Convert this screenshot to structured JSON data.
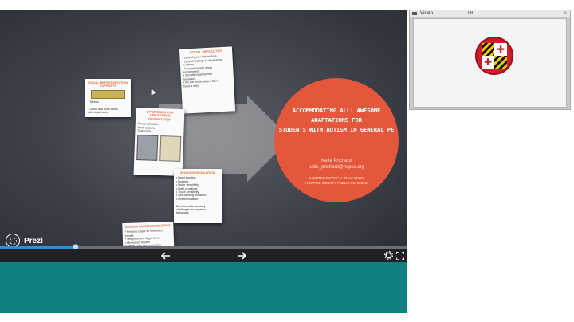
{
  "presentation": {
    "title": "ACCOMMODATING ALL: AWESOME ADAPTATIONS FOR\nSTUDENTS WITH AUTISM IN GENERAL PE",
    "author": "Katie Prichard",
    "email": "katie_prichard@hcpss.org",
    "org": "ADAPTED PHYSICAL EDUCATION\nHOWARD COUNTY PUBLIC SCHOOLS",
    "colors": {
      "accent": "#e4573a",
      "title_text": "#ffffff"
    }
  },
  "cards": [
    {
      "title": "Visual Representation Supports",
      "lines": "• Tokens\n\n• Social and rules cards\n  with visual cues"
    },
    {
      "title": "Social Difficulties",
      "lines": "• Lack of peer relationships\n• Lack of sharing or responding\n  to others\n• Frustration with group\n  assignments\n• Socially inappropriate\n  behaviors\n• It's the relationships! Don't\n  force a stay"
    },
    {
      "title": "Strategies for Structured Organization",
      "lines": "Visual schedules\nWork stations\nTask cards"
    },
    {
      "title": "Sensory Regulation",
      "lines": "• Hand flapping\n• Rocking\n• Motor sensitivity\n• Light sensitivity\n• Touch sensitivity\n• Self-calming behaviors\n• Overstimulation\n\nDon't consider sensory\nchallenges as negative\nbehaviors"
    },
    {
      "title": "Sensory Accommodations",
      "lines": "• Sensory space w/ movement breaks\n• Weighted and fidget items\n• Movement breaks\n• Visual cues and schedules\n• Equipment\n• Fidgets"
    }
  ],
  "branding": {
    "logo_text": "Prezi"
  },
  "player": {
    "progress": 0.185,
    "prev_icon": "arrow-left-icon",
    "next_icon": "arrow-right-icon",
    "settings_icon": "gear-icon",
    "fullscreen_icon": "fullscreen-icon"
  },
  "video_panel": {
    "title": "Video",
    "status": "IIH",
    "close": "×",
    "seal_description": "maryland-flag-seal"
  }
}
